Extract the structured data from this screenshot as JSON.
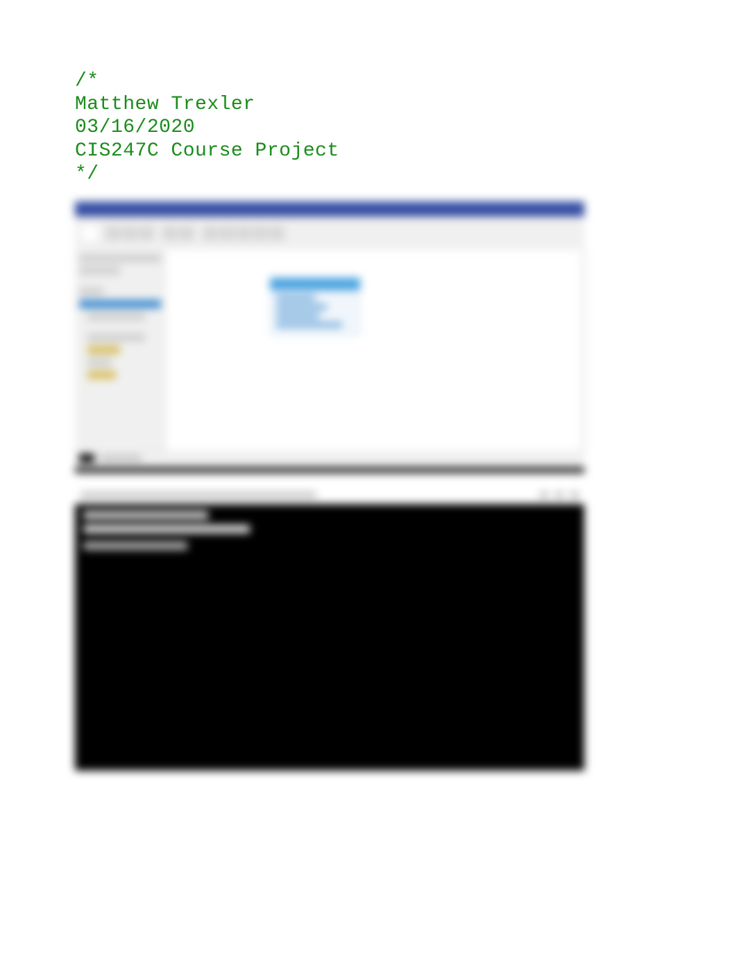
{
  "code_comment": {
    "open": "/*",
    "line1": "Matthew Trexler",
    "line2": "03/16/2020",
    "line3": "CIS247C Course Project",
    "close": "*/"
  },
  "ide": {
    "titlebar_color": "#3c56a8",
    "sidebar_items": [
      "item",
      "item"
    ],
    "selected_item": "item",
    "class_diagram": {
      "header_color": "#4aa3e0",
      "rows": 4
    }
  },
  "console": {
    "background": "#000000",
    "lines": 3
  }
}
